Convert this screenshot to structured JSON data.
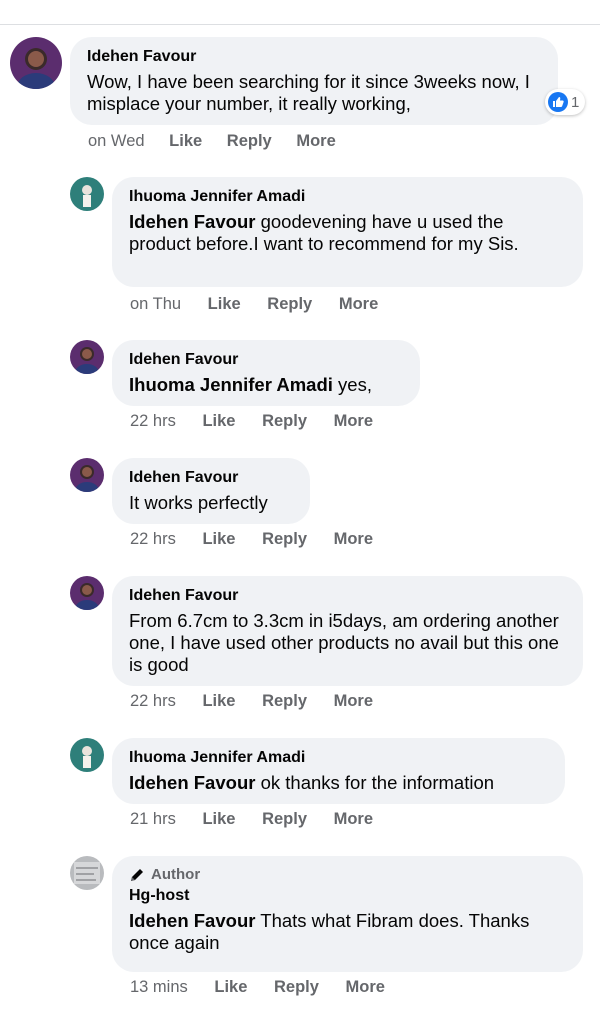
{
  "comments": [
    {
      "author": "Idehen Favour",
      "text": "Wow, I have been searching for it since 3weeks now, I misplace your number, it really working,",
      "reaction_count": "1",
      "time": "on Wed",
      "actions": [
        "Like",
        "Reply",
        "More"
      ]
    },
    {
      "author": "Ihuoma Jennifer Amadi",
      "mention": "Idehen Favour",
      "text": "goodevening have u used the product before.I want to recommend for my Sis.",
      "time": "on Thu",
      "actions": [
        "Like",
        "Reply",
        "More"
      ]
    },
    {
      "author": "Idehen Favour",
      "mention": "Ihuoma Jennifer Amadi",
      "text": "yes,",
      "time": "22 hrs",
      "actions": [
        "Like",
        "Reply",
        "More"
      ]
    },
    {
      "author": "Idehen Favour",
      "text": "It works perfectly",
      "time": "22 hrs",
      "actions": [
        "Like",
        "Reply",
        "More"
      ]
    },
    {
      "author": "Idehen Favour",
      "text": "From 6.7cm to 3.3cm in i5days, am ordering another one, I have used other products no avail but this one is good",
      "time": "22 hrs",
      "actions": [
        "Like",
        "Reply",
        "More"
      ]
    },
    {
      "author": "Ihuoma Jennifer Amadi",
      "mention": "Idehen Favour",
      "text": "ok thanks for the information",
      "time": "21 hrs",
      "actions": [
        "Like",
        "Reply",
        "More"
      ]
    },
    {
      "badge": "Author",
      "author": "Hg-host",
      "mention": "Idehen Favour",
      "text": "Thats what Fibram does. Thanks once again",
      "time": "13 mins",
      "actions": [
        "Like",
        "Reply",
        "More"
      ]
    }
  ],
  "icons": {
    "like": "thumbs-up-icon",
    "author": "pencil-icon"
  },
  "colors": {
    "bubble": "#f0f2f5",
    "meta_text": "#65676b",
    "like_blue": "#1877f2"
  }
}
